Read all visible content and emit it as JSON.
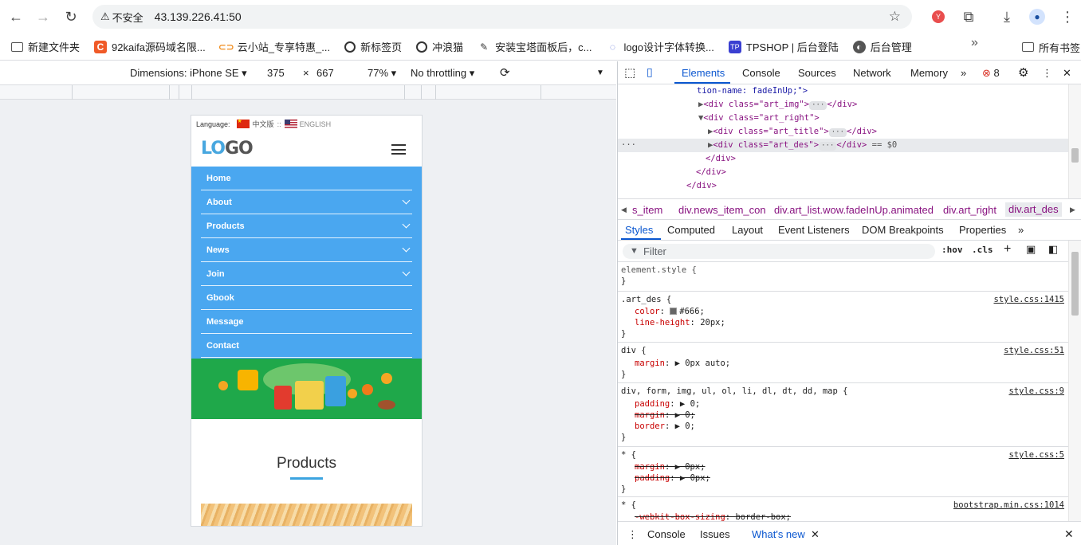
{
  "browser": {
    "security_label": "不安全",
    "url": "43.139.226.41:50",
    "bookmarks": [
      {
        "label": "新建文件夹",
        "icon": "folder-icon"
      },
      {
        "label": "92kaifa源码域名限...",
        "icon": "site-c-icon"
      },
      {
        "label": "云小站_专享特惠_...",
        "icon": "cloud-icon"
      },
      {
        "label": "新标签页",
        "icon": "edge-icon"
      },
      {
        "label": "冲浪猫",
        "icon": "edge-icon"
      },
      {
        "label": "安装宝塔面板后，c...",
        "icon": "pin-icon"
      },
      {
        "label": "logo设计字体转换...",
        "icon": "font-icon"
      },
      {
        "label": "TPSHOP | 后台登陆",
        "icon": "tp-icon"
      },
      {
        "label": "后台管理",
        "icon": "globe-icon"
      }
    ],
    "all_bookmarks_label": "所有书签"
  },
  "device_toolbar": {
    "dimensions_label": "Dimensions: iPhone SE ▾",
    "width": "375",
    "times": "×",
    "height": "667",
    "zoom": "77% ▾",
    "throttling": "No throttling ▾"
  },
  "site": {
    "language_label": "Language:",
    "lang_cn": "中文版",
    "lang_sep": "::",
    "lang_en": "ENGLISH",
    "logo_part1": "LO",
    "logo_part2": "GO",
    "menu": [
      {
        "label": "Home",
        "has_children": false
      },
      {
        "label": "About",
        "has_children": true
      },
      {
        "label": "Products",
        "has_children": true
      },
      {
        "label": "News",
        "has_children": true
      },
      {
        "label": "Join",
        "has_children": true
      },
      {
        "label": "Gbook",
        "has_children": false
      },
      {
        "label": "Message",
        "has_children": false
      },
      {
        "label": "Contact",
        "has_children": false
      }
    ],
    "section_title": "Products",
    "accent_color": "#4aa7f0"
  },
  "devtools": {
    "tabs": [
      "Elements",
      "Console",
      "Sources",
      "Network",
      "Memory"
    ],
    "active_tab": "Elements",
    "error_count": "8",
    "code_lines": [
      {
        "t": "tion-name: fadeInUp;\">",
        "kind": "attrtail"
      },
      {
        "t": "<div class=\"art_img\">",
        "kind": "collapsed"
      },
      {
        "t": "<div class=\"art_right\">",
        "kind": "expanded"
      },
      {
        "t": "<div class=\"art_title\">",
        "kind": "collapsed"
      },
      {
        "t": "<div class=\"art_des\">",
        "kind": "selected",
        "suffix": "== $0"
      },
      {
        "t": "</div>",
        "kind": "close"
      },
      {
        "t": "</div>",
        "kind": "close"
      },
      {
        "t": "</div>",
        "kind": "close"
      }
    ],
    "breadcrumbs": [
      "s_item",
      "div.news_item_con",
      "div.art_list.wow.fadeInUp.animated",
      "div.art_right",
      "div.art_des"
    ],
    "styles_tabs": [
      "Styles",
      "Computed",
      "Layout",
      "Event Listeners",
      "DOM Breakpoints",
      "Properties"
    ],
    "filter_placeholder": "Filter",
    "hov": ":hov",
    "cls": ".cls",
    "rules": [
      {
        "selector": "element.style {",
        "source": "",
        "props": []
      },
      {
        "selector": ".art_des {",
        "source": "style.css:1415",
        "props": [
          {
            "name": "color",
            "value": "#666;",
            "struck": false,
            "swatch": true
          },
          {
            "name": "line-height",
            "value": "20px;",
            "struck": false
          }
        ]
      },
      {
        "selector": "div {",
        "source": "style.css:51",
        "props": [
          {
            "name": "margin",
            "value": "▶ 0px auto;",
            "struck": false
          }
        ]
      },
      {
        "selector": "div, form, img, ul, ol, li, dl, dt, dd, map {",
        "source": "style.css:9",
        "props": [
          {
            "name": "padding",
            "value": "▶ 0;",
            "struck": false
          },
          {
            "name": "margin",
            "value": "▶ 0;",
            "struck": true
          },
          {
            "name": "border",
            "value": "▶ 0;",
            "struck": false
          }
        ]
      },
      {
        "selector": "* {",
        "source": "style.css:5",
        "props": [
          {
            "name": "margin",
            "value": "▶ 0px;",
            "struck": true
          },
          {
            "name": "padding",
            "value": "▶ 0px;",
            "struck": true
          }
        ]
      },
      {
        "selector": "* {",
        "source": "bootstrap.min.css:1014",
        "props": [
          {
            "name": "-webkit-box-sizing",
            "value": "border-box;",
            "struck": true
          }
        ]
      }
    ],
    "drawer_tabs": [
      "Console",
      "Issues",
      "What's new"
    ]
  }
}
